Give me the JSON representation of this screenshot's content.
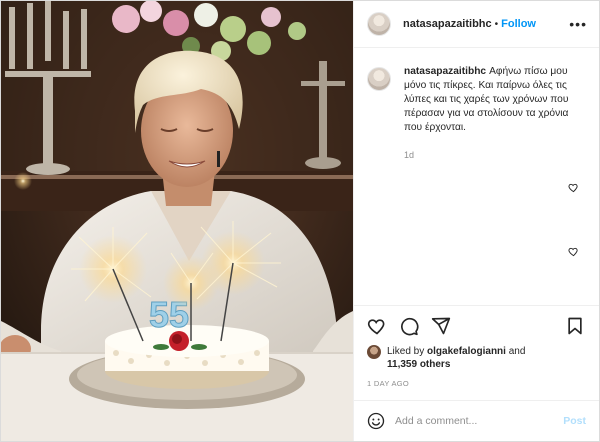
{
  "post": {
    "username": "natasapazaitibhc",
    "follow_label": "Follow",
    "separator": "•",
    "more_icon": "more-options-icon",
    "caption": "Αφήνω πίσω μου μόνο τις πίκρες. Και παίρνω όλες τις λύπες και τις χαρές των χρόνων που πέρασαν για να στολίσουν τα χρόνια που έρχονται.",
    "caption_age": "1d",
    "liked_by_prefix": "Liked by",
    "liked_by_user": "olgakefalogianni",
    "liked_by_and": "and",
    "others_count": "11,359 others",
    "time_ago": "1 DAY AGO",
    "comment_placeholder": "Add a comment...",
    "post_label": "Post"
  },
  "icons": {
    "like": "heart-icon",
    "comment": "comment-icon",
    "share": "share-icon",
    "save": "bookmark-icon",
    "emoji": "emoji-icon"
  },
  "colors": {
    "link_blue": "#0095f6",
    "post_disabled": "#b2dffc",
    "muted": "#8e8e8e",
    "text": "#262626"
  },
  "photo": {
    "cake_number": "55"
  }
}
